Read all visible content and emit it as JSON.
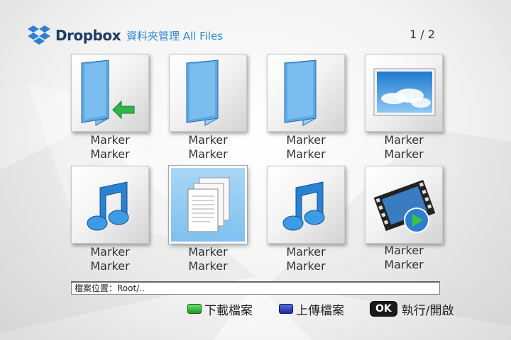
{
  "header": {
    "brand": "Dropbox",
    "title": "資料夾管理 All Files",
    "page_indicator": "1 / 2"
  },
  "items": [
    {
      "line1": "Marker",
      "line2": "Marker",
      "icon": "folder-back-icon"
    },
    {
      "line1": "Marker",
      "line2": "Marker",
      "icon": "folder-icon"
    },
    {
      "line1": "Marker",
      "line2": "Marker",
      "icon": "folder-icon"
    },
    {
      "line1": "Marker",
      "line2": "Marker",
      "icon": "image-file-icon"
    },
    {
      "line1": "Marker",
      "line2": "Marker",
      "icon": "music-file-icon"
    },
    {
      "line1": "Marker",
      "line2": "Marker",
      "icon": "document-file-icon",
      "selected": true
    },
    {
      "line1": "Marker",
      "line2": "Marker",
      "icon": "music-file-icon"
    },
    {
      "line1": "Marker",
      "line2": "Marker",
      "icon": "video-file-icon"
    }
  ],
  "path_bar": {
    "text": "檔案位置：Root/.."
  },
  "footer": {
    "download": "下載檔案",
    "upload": "上傳檔案",
    "ok_key": "OK",
    "execute": "執行/開啟"
  },
  "colors": {
    "accent": "#2b8bd6",
    "brand": "#1b3b66",
    "selected": "#7fc0ef"
  }
}
